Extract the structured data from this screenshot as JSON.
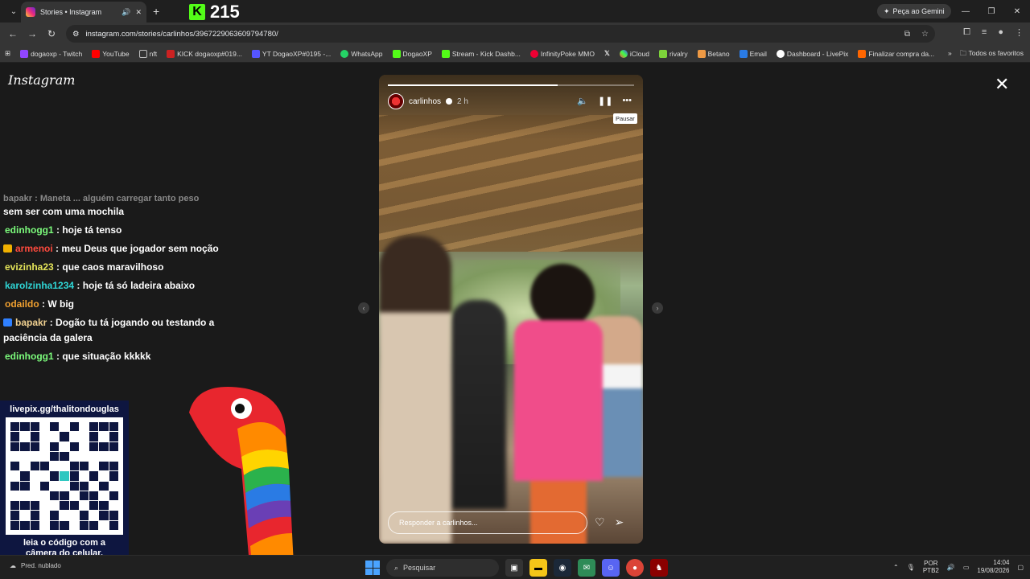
{
  "browser": {
    "tab_title": "Stories • Instagram",
    "kick_number": "215",
    "gemini_label": "Peça ao Gemini",
    "url": "instagram.com/stories/carlinhos/3967229063609794780/",
    "bookmarks": [
      "dogaoxp - Twitch",
      "YouTube",
      "nft",
      "KICK dogaoxp#019...",
      "YT DogaoXP#0195 -...",
      "WhatsApp",
      "DogaoXP",
      "Stream - Kick Dashb...",
      "InfinityPoke MMO",
      "",
      "iCloud",
      "rivalry",
      "Betano",
      "Email",
      "Dashboard - LivePix",
      "Finalizar compra da..."
    ],
    "all_bookmarks": "Todos os favoritos"
  },
  "instagram": {
    "logo": "Instagram",
    "story": {
      "username": "carlinhos",
      "time": "2 h",
      "tooltip": "Pausar",
      "reply_placeholder": "Responder a carlinhos...",
      "progress": 0.69
    }
  },
  "chat": {
    "cut_line": "bapakr : Maneta ... alguém carregar tanto peso",
    "first_line_cont": "sem ser com uma mochila",
    "messages": [
      {
        "user": "edinhogg1",
        "text": ": hoje tá tenso",
        "color": "#7cfc7c",
        "badge": ""
      },
      {
        "user": "armenoi",
        "text": ": meu Deus que jogador sem noção",
        "color": "#ff4a3d",
        "badge": "#f0b000"
      },
      {
        "user": "evizinha23",
        "text": ": que caos maravilhoso",
        "color": "#e6e65a",
        "badge": ""
      },
      {
        "user": "karolzinha1234",
        "text": ": hoje tá só ladeira abaixo",
        "color": "#2fd6d6",
        "badge": ""
      },
      {
        "user": "odaildo",
        "text": ": W big",
        "color": "#f0a030",
        "badge": ""
      },
      {
        "user": "bapakr",
        "text": ": Dogão tu tá jogando ou testando a",
        "color": "#f0d090",
        "badge": "#2f80ff"
      },
      {
        "user": "",
        "text": "paciência da galera",
        "color": "#fff",
        "badge": ""
      },
      {
        "user": "edinhogg1",
        "text": ": que situação kkkkk",
        "color": "#7cfc7c",
        "badge": ""
      }
    ]
  },
  "qr": {
    "title": "livepix.gg/thalitondouglas",
    "footer1": "leia o código com a",
    "footer2": "câmera do celular."
  },
  "taskbar": {
    "weather": "Pred. nublado",
    "search": "Pesquisar",
    "lang1": "POR",
    "lang2": "PTB2",
    "time": "14:04",
    "date": "19/08/2026"
  }
}
